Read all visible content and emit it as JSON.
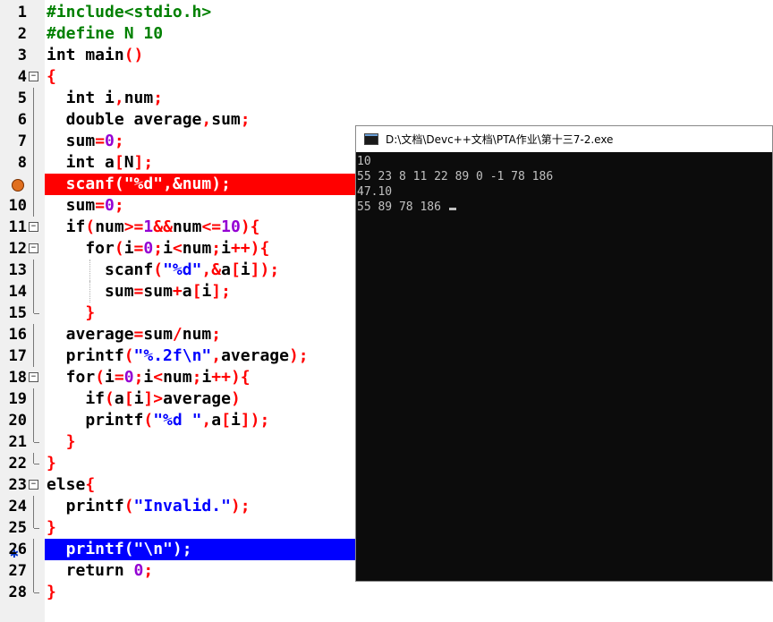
{
  "editor": {
    "lines": [
      {
        "n": "1",
        "html": "<span class='pp'>#include&lt;stdio.h&gt;</span>"
      },
      {
        "n": "2",
        "html": "<span class='pp'>#define N 10</span>"
      },
      {
        "n": "3",
        "html": "int main<span class='sym'>()</span>"
      },
      {
        "n": "4",
        "html": "<span class='sym'>{</span>"
      },
      {
        "n": "5",
        "html": "  int i<span class='sym'>,</span>num<span class='sym'>;</span>"
      },
      {
        "n": "6",
        "html": "  double average<span class='sym'>,</span>sum<span class='sym'>;</span>"
      },
      {
        "n": "7",
        "html": "  sum<span class='sym'>=</span><span class='num'>0</span><span class='sym'>;</span>"
      },
      {
        "n": "8",
        "html": "  int a<span class='sym'>[</span>N<span class='sym'>];</span>"
      },
      {
        "n": "9",
        "html": "  scanf(\"%d\",&amp;num);"
      },
      {
        "n": "10",
        "html": "  sum<span class='sym'>=</span><span class='num'>0</span><span class='sym'>;</span>"
      },
      {
        "n": "11",
        "html": "  if<span class='sym'>(</span>num<span class='sym'>&gt;=</span><span class='num'>1</span><span class='sym'>&amp;&amp;</span>num<span class='sym'>&lt;=</span><span class='num'>10</span><span class='sym'>){</span>"
      },
      {
        "n": "12",
        "html": "    for<span class='sym'>(</span>i<span class='sym'>=</span><span class='num'>0</span><span class='sym'>;</span>i<span class='sym'>&lt;</span>num<span class='sym'>;</span>i<span class='sym'>++){</span>"
      },
      {
        "n": "13",
        "html": "      scanf<span class='sym'>(</span><span class='str'>\"%d\"</span><span class='sym'>,&amp;</span>a<span class='sym'>[</span>i<span class='sym'>]);</span>"
      },
      {
        "n": "14",
        "html": "      sum<span class='sym'>=</span>sum<span class='sym'>+</span>a<span class='sym'>[</span>i<span class='sym'>];</span>"
      },
      {
        "n": "15",
        "html": "    <span class='sym'>}</span>"
      },
      {
        "n": "16",
        "html": "  average<span class='sym'>=</span>sum<span class='sym'>/</span>num<span class='sym'>;</span>"
      },
      {
        "n": "17",
        "html": "  printf<span class='sym'>(</span><span class='str'>\"%.2f\\n\"</span><span class='sym'>,</span>average<span class='sym'>);</span>"
      },
      {
        "n": "18",
        "html": "  for<span class='sym'>(</span>i<span class='sym'>=</span><span class='num'>0</span><span class='sym'>;</span>i<span class='sym'>&lt;</span>num<span class='sym'>;</span>i<span class='sym'>++){</span>"
      },
      {
        "n": "19",
        "html": "    if<span class='sym'>(</span>a<span class='sym'>[</span>i<span class='sym'>]&gt;</span>average<span class='sym'>)</span>"
      },
      {
        "n": "20",
        "html": "    printf<span class='sym'>(</span><span class='str'>\"%d \"</span><span class='sym'>,</span>a<span class='sym'>[</span>i<span class='sym'>]);</span>"
      },
      {
        "n": "21",
        "html": "  <span class='sym'>}</span>"
      },
      {
        "n": "22",
        "html": "<span class='sym'>}</span>"
      },
      {
        "n": "23",
        "html": "else<span class='sym'>{</span>"
      },
      {
        "n": "24",
        "html": "  printf<span class='sym'>(</span><span class='str'>\"Invalid.\"</span><span class='sym'>);</span>"
      },
      {
        "n": "25",
        "html": "<span class='sym'>}</span>"
      },
      {
        "n": "26",
        "html": "  printf(\"\\n\");"
      },
      {
        "n": "27",
        "html": "  return <span class='num'>0</span><span class='sym'>;</span>"
      },
      {
        "n": "28",
        "html": "<span class='sym'>}</span>"
      }
    ],
    "breakpoint_line": "9",
    "current_line": "26",
    "breakpoint_color": "#ff0000",
    "current_line_color": "#0000ff",
    "breakpoint_icon": "breakpoint-icon",
    "current_line_icon": "execution-arrow-icon"
  },
  "console": {
    "title": "D:\\文档\\Devc++文档\\PTA作业\\第十三7-2.exe",
    "output": [
      "10",
      "55 23 8 11 22 89 0 -1 78 186",
      "47.10",
      "55 89 78 186 "
    ]
  }
}
